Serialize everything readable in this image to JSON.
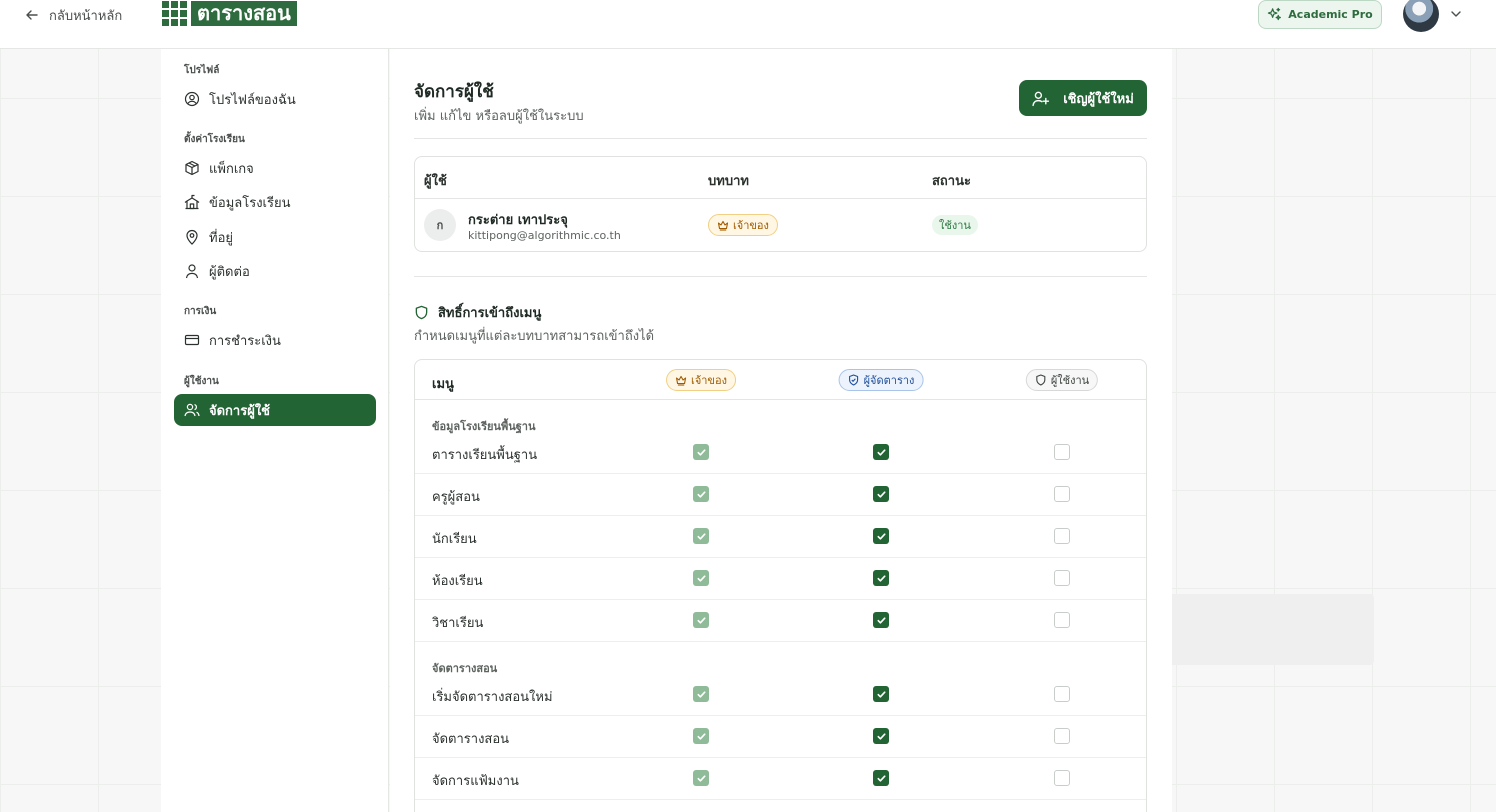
{
  "topbar": {
    "back_label": "กลับหน้าหลัก",
    "logo_text": "ตารางสอน",
    "plan_label": "Academic Pro"
  },
  "sidebar": {
    "groups": [
      {
        "label": "โปรไฟล์"
      },
      {
        "label": "ตั้งค่าโรงเรียน"
      },
      {
        "label": "การเงิน"
      },
      {
        "label": "ผู้ใช้งาน"
      }
    ],
    "items": [
      {
        "label": "โปรไฟล์ของฉัน",
        "icon": "user-circle-icon"
      },
      {
        "label": "แพ็กเกจ",
        "icon": "package-icon"
      },
      {
        "label": "ข้อมูลโรงเรียน",
        "icon": "school-icon"
      },
      {
        "label": "ที่อยู่",
        "icon": "map-pin-icon"
      },
      {
        "label": "ผู้ติดต่อ",
        "icon": "user-icon"
      },
      {
        "label": "การชำระเงิน",
        "icon": "credit-card-icon"
      },
      {
        "label": "จัดการผู้ใช้",
        "icon": "users-icon",
        "active": true
      }
    ]
  },
  "main": {
    "title": "จัดการผู้ใช้",
    "subtitle": "เพิ่ม แก้ไข หรือลบผู้ใช้ในระบบ",
    "invite_label": "เชิญผู้ใช้ใหม่",
    "users_table": {
      "headers": [
        "ผู้ใช้",
        "บทบาท",
        "สถานะ"
      ],
      "rows": [
        {
          "initial": "ก",
          "name": "กระต่าย เทาประจุ",
          "email": "kittipong@algorithmic.co.th",
          "role": "เจ้าของ",
          "status": "ใช้งาน"
        }
      ]
    },
    "permissions": {
      "title": "สิทธิ์การเข้าถึงเมนู",
      "subtitle": "กำหนดเมนูที่แต่ละบทบาทสามารถเข้าถึงได้",
      "menu_header": "เมนู",
      "columns": [
        "เจ้าของ",
        "ผู้จัดตาราง",
        "ผู้ใช้งาน"
      ],
      "sections": [
        {
          "label": "ข้อมูลโรงเรียนพื้นฐาน",
          "rows": [
            {
              "label": "ตารางเรียนพื้นฐาน",
              "owner": true,
              "scheduler": true,
              "user": false
            },
            {
              "label": "ครูผู้สอน",
              "owner": true,
              "scheduler": true,
              "user": false
            },
            {
              "label": "นักเรียน",
              "owner": true,
              "scheduler": true,
              "user": false
            },
            {
              "label": "ห้องเรียน",
              "owner": true,
              "scheduler": true,
              "user": false
            },
            {
              "label": "วิชาเรียน",
              "owner": true,
              "scheduler": true,
              "user": false
            }
          ]
        },
        {
          "label": "จัดตารางสอน",
          "rows": [
            {
              "label": "เริ่มจัดตารางสอนใหม่",
              "owner": true,
              "scheduler": true,
              "user": false
            },
            {
              "label": "จัดตารางสอน",
              "owner": true,
              "scheduler": true,
              "user": false
            },
            {
              "label": "จัดการแฟ้มงาน",
              "owner": true,
              "scheduler": true,
              "user": false
            }
          ]
        }
      ]
    }
  },
  "colors": {
    "brand": "#236434",
    "owner_badge": "#a05a00",
    "scheduler_badge": "#1d4f9a",
    "status_active": "#2e7a43"
  }
}
